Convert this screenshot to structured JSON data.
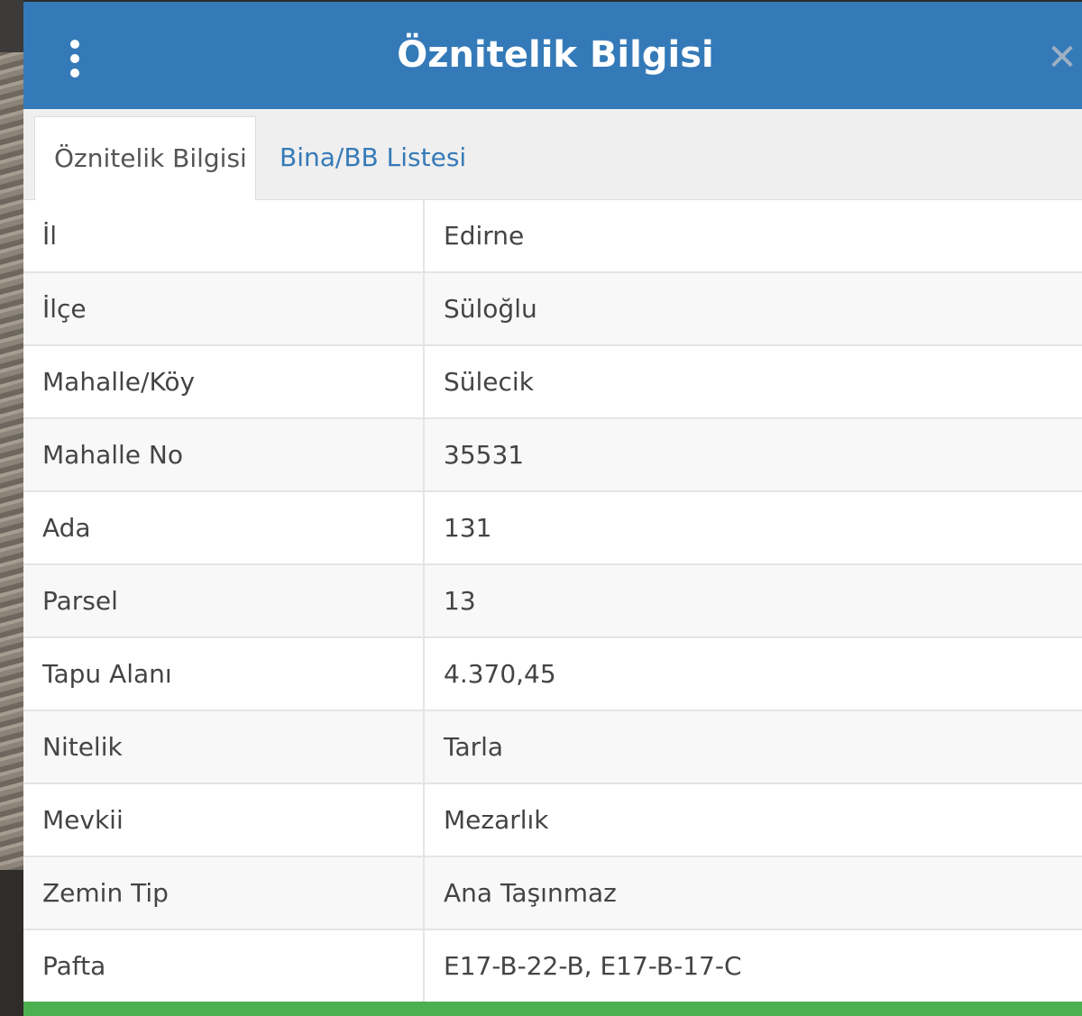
{
  "header": {
    "title": "Öznitelik Bilgisi",
    "menu_icon": "vertical-ellipsis-icon",
    "close_icon": "close-icon",
    "close_glyph": "✕"
  },
  "tabs": [
    {
      "label": "Öznitelik Bilgisi",
      "active": true
    },
    {
      "label": "Bina/BB Listesi",
      "active": false
    }
  ],
  "attributes": [
    {
      "key": "İl",
      "value": "Edirne"
    },
    {
      "key": "İlçe",
      "value": "Süloğlu"
    },
    {
      "key": "Mahalle/Köy",
      "value": "Sülecik"
    },
    {
      "key": "Mahalle No",
      "value": "35531"
    },
    {
      "key": "Ada",
      "value": "131"
    },
    {
      "key": "Parsel",
      "value": "13"
    },
    {
      "key": "Tapu Alanı",
      "value": "4.370,45"
    },
    {
      "key": "Nitelik",
      "value": "Tarla"
    },
    {
      "key": "Mevkii",
      "value": "Mezarlık"
    },
    {
      "key": "Zemin Tip",
      "value": "Ana Taşınmaz"
    },
    {
      "key": "Pafta",
      "value": "E17-B-22-B, E17-B-17-C"
    }
  ],
  "colors": {
    "header_bg": "#357ab8",
    "tab_link": "#357ab8",
    "bottom_bar": "#4caf50"
  }
}
